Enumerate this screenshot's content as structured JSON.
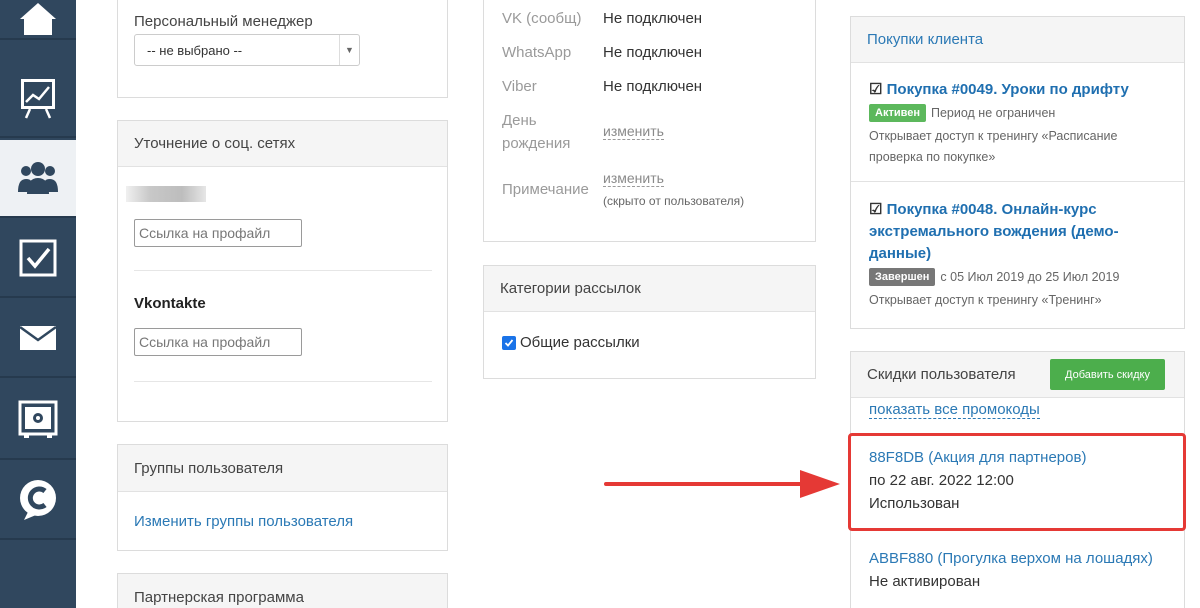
{
  "sidebar": {
    "items": [
      {
        "icon": "home-icon"
      },
      {
        "icon": "chart-board-icon"
      },
      {
        "icon": "users-icon",
        "active": true
      },
      {
        "icon": "checkbox-icon"
      },
      {
        "icon": "mail-icon"
      },
      {
        "icon": "safe-icon"
      },
      {
        "icon": "brand-c-icon"
      }
    ]
  },
  "manager": {
    "label": "Персональный менеджер",
    "select_value": "-- не выбрано --"
  },
  "social": {
    "title": "Уточнение о соц. сетях",
    "field1_placeholder": "Ссылка на профайл",
    "vk_label": "Vkontakte",
    "field2_placeholder": "Ссылка на профайл"
  },
  "groups": {
    "title": "Группы пользователя",
    "link": "Изменить группы пользователя"
  },
  "partner": {
    "title": "Партнерская программа"
  },
  "contacts": {
    "rows": [
      {
        "label": "VK (сообщ)",
        "value": "Не подключен"
      },
      {
        "label": "WhatsApp",
        "value": "Не подключен"
      },
      {
        "label": "Viber",
        "value": "Не подключен"
      }
    ],
    "birthday_label_1": "День",
    "birthday_label_2": "рождения",
    "birthday_action": "изменить",
    "note_label": "Примечание",
    "note_action": "изменить",
    "note_hint": "(скрыто от пользователя)"
  },
  "mailing": {
    "title": "Категории рассылок",
    "option_label": "Общие рассылки",
    "option_checked": true
  },
  "purchases": {
    "title": "Покупки клиента",
    "items": [
      {
        "title_1": "Покупка #0049. Уроки по дрифту",
        "badge": "Активен",
        "badge_color": "#5cb85c",
        "period": "Период не ограничен",
        "access_1": "Открывает доступ к тренингу «Расписание",
        "access_2": "проверка по покупке»"
      },
      {
        "title_1": "Покупка #0048. Онлайн-курс",
        "title_2": "экстремального вождения (демо-",
        "title_3": "данные)",
        "badge": "Завершен",
        "badge_color": "#777777",
        "period": "с 05 Июл 2019 до 25 Июл 2019",
        "access_1": "Открывает доступ к тренингу «Тренинг»"
      }
    ]
  },
  "discounts": {
    "title": "Скидки пользователя",
    "add_button": "Добавить скидку",
    "show_all": "показать все промокоды",
    "items": [
      {
        "code": "88F8DB",
        "name": "(Акция для партнеров)",
        "until": "по 22 авг. 2022 12:00",
        "status": "Использован"
      },
      {
        "code": "ABBF880",
        "name": "(Прогулка верхом на лошадях)",
        "status": "Не активирован"
      }
    ]
  },
  "colors": {
    "sidebar": "#30475e",
    "link": "#2b79b5",
    "highlight": "#e53935",
    "add_button": "#4cae4c"
  }
}
